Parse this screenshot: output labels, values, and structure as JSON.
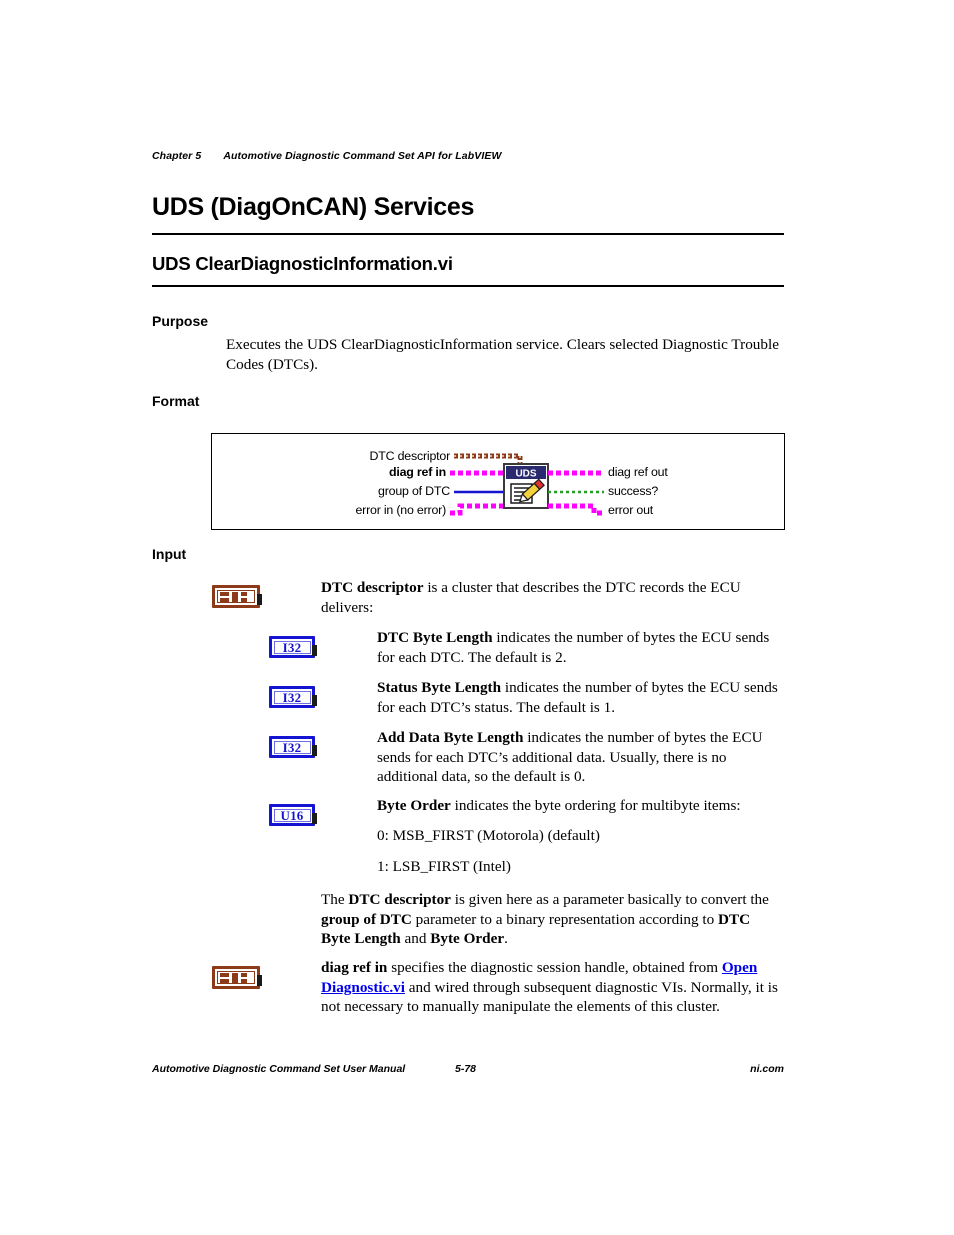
{
  "header": {
    "chapter": "Chapter 5",
    "chapter_title": "Automotive Diagnostic Command Set API for LabVIEW"
  },
  "title": "UDS (DiagOnCAN) Services",
  "subtitle": "UDS ClearDiagnosticInformation.vi",
  "sections": {
    "purpose_heading": "Purpose",
    "purpose_text": "Executes the UDS ClearDiagnosticInformation service. Clears selected Diagnostic Trouble Codes (DTCs).",
    "format_heading": "Format",
    "input_heading": "Input"
  },
  "connector_pane": {
    "inputs": [
      {
        "label": "DTC descriptor",
        "bold": false,
        "wire": "cluster-brown"
      },
      {
        "label": "diag ref in",
        "bold": true,
        "wire": "refnum-magenta"
      },
      {
        "label": "group of DTC",
        "bold": false,
        "wire": "numeric-blue"
      },
      {
        "label": "error in (no error)",
        "bold": false,
        "wire": "error-magenta"
      }
    ],
    "outputs": [
      {
        "label": "diag ref out",
        "bold": false,
        "wire": "refnum-magenta"
      },
      {
        "label": "success?",
        "bold": false,
        "wire": "boolean-green"
      },
      {
        "label": "error out",
        "bold": false,
        "wire": "error-magenta"
      }
    ],
    "icon_title": "UDS",
    "icon_name": "uds-vi-icon"
  },
  "input_items": [
    {
      "terminal": "cluster",
      "terminal_label": "",
      "indent": 1,
      "parts": [
        {
          "t": "DTC descriptor",
          "style": "bold"
        },
        {
          "t": " is a cluster that describes the DTC records the ECU delivers:",
          "style": "normal"
        }
      ]
    },
    {
      "terminal": "numeric",
      "terminal_label": "I32",
      "indent": 2,
      "parts": [
        {
          "t": "DTC Byte Length",
          "style": "bold"
        },
        {
          "t": " indicates the number of bytes the ECU sends for each DTC. The default is 2.",
          "style": "normal"
        }
      ]
    },
    {
      "terminal": "numeric",
      "terminal_label": "I32",
      "indent": 2,
      "parts": [
        {
          "t": "Status Byte Length",
          "style": "bold"
        },
        {
          "t": " indicates the number of bytes the ECU sends for each DTC’s status. The default is 1.",
          "style": "normal"
        }
      ]
    },
    {
      "terminal": "numeric",
      "terminal_label": "I32",
      "indent": 2,
      "parts": [
        {
          "t": "Add Data Byte Length",
          "style": "bold"
        },
        {
          "t": " indicates the number of bytes the ECU sends for each DTC’s additional data. Usually, there is no additional data, so the default is 0.",
          "style": "normal"
        }
      ]
    },
    {
      "terminal": "numeric",
      "terminal_label": "U16",
      "indent": 2,
      "parts": [
        {
          "t": "Byte Order",
          "style": "bold"
        },
        {
          "t": " indicates the byte ordering for multibyte items:",
          "style": "normal"
        }
      ]
    }
  ],
  "byte_order_options": [
    "0: MSB_FIRST (Motorola) (default)",
    "1: LSB_FIRST (Intel)"
  ],
  "descriptor_note": [
    {
      "t": "The ",
      "style": "normal"
    },
    {
      "t": "DTC descriptor",
      "style": "bold"
    },
    {
      "t": " is given here as a parameter basically to convert the ",
      "style": "normal"
    },
    {
      "t": "group of DTC",
      "style": "bold"
    },
    {
      "t": " parameter to a binary representation according to ",
      "style": "normal"
    },
    {
      "t": "DTC Byte Length",
      "style": "bold"
    },
    {
      "t": " and ",
      "style": "normal"
    },
    {
      "t": "Byte Order",
      "style": "bold"
    },
    {
      "t": ".",
      "style": "normal"
    }
  ],
  "diag_ref_note": [
    {
      "t": "diag ref in",
      "style": "bold"
    },
    {
      "t": " specifies the diagnostic session handle, obtained from ",
      "style": "normal"
    },
    {
      "t": "Open Diagnostic.vi",
      "style": "link"
    },
    {
      "t": " and wired through subsequent diagnostic VIs. Normally, it is not necessary to manually manipulate the elements of this cluster.",
      "style": "normal"
    }
  ],
  "footer": {
    "left": "Automotive Diagnostic Command Set User Manual",
    "page": "5-78",
    "right": "ni.com"
  },
  "colors": {
    "cluster_brown": "#8c3a17",
    "refnum_magenta": "#ff00ff",
    "numeric_blue": "#1414d2",
    "boolean_green": "#22a022",
    "link_blue": "#0000ee",
    "icon_header": "#2a2a6e"
  }
}
